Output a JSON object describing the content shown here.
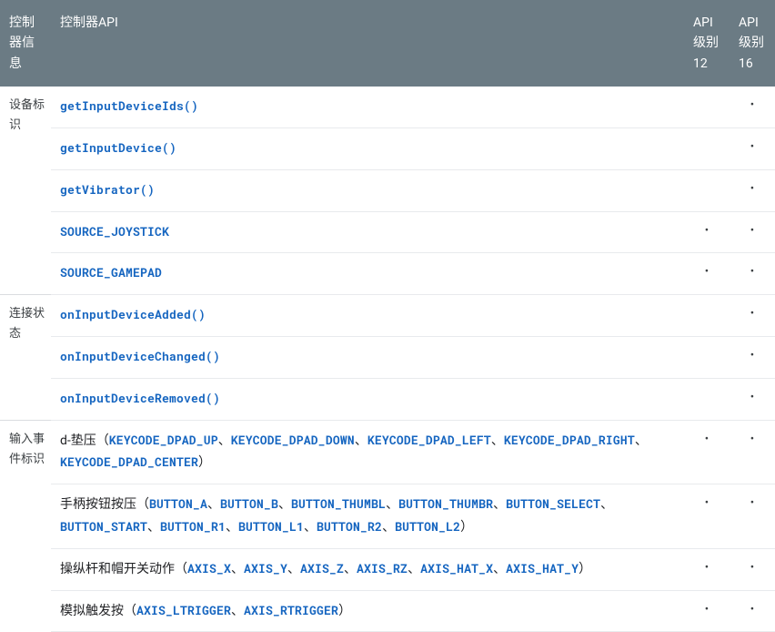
{
  "headers": {
    "info": "控制器信息",
    "controller_api": "控制器API",
    "api12": "API 级别 12",
    "api16": "API 级别 16"
  },
  "sections": [
    {
      "category": "设备标识",
      "rows": [
        {
          "type": "single",
          "items": [
            {
              "text": "getInputDeviceIds()",
              "link": true
            }
          ],
          "api12": "",
          "api16": "•"
        },
        {
          "type": "single",
          "items": [
            {
              "text": "getInputDevice()",
              "link": true
            }
          ],
          "api12": "",
          "api16": "•"
        },
        {
          "type": "single",
          "items": [
            {
              "text": "getVibrator()",
              "link": true
            }
          ],
          "api12": "",
          "api16": "•"
        },
        {
          "type": "single",
          "items": [
            {
              "text": "SOURCE_JOYSTICK",
              "link": true
            }
          ],
          "api12": "•",
          "api16": "•"
        },
        {
          "type": "single",
          "items": [
            {
              "text": "SOURCE_GAMEPAD",
              "link": true
            }
          ],
          "api12": "•",
          "api16": "•"
        }
      ]
    },
    {
      "category": "连接状态",
      "rows": [
        {
          "type": "single",
          "items": [
            {
              "text": "onInputDeviceAdded()",
              "link": true
            }
          ],
          "api12": "",
          "api16": "•"
        },
        {
          "type": "single",
          "items": [
            {
              "text": "onInputDeviceChanged()",
              "link": true
            }
          ],
          "api12": "",
          "api16": "•"
        },
        {
          "type": "single",
          "items": [
            {
              "text": "onInputDeviceRemoved()",
              "link": true
            }
          ],
          "api12": "",
          "api16": "•"
        }
      ]
    },
    {
      "category": "输入事件标识",
      "rows": [
        {
          "type": "composite",
          "prefix": "d-垫压（",
          "items": [
            {
              "text": "KEYCODE_DPAD_UP",
              "link": true
            },
            {
              "text": "KEYCODE_DPAD_DOWN",
              "link": true
            },
            {
              "text": "KEYCODE_DPAD_LEFT",
              "link": true
            },
            {
              "text": "KEYCODE_DPAD_RIGHT",
              "link": true
            },
            {
              "text": "KEYCODE_DPAD_CENTER",
              "link": true
            }
          ],
          "suffix": "）",
          "api12": "•",
          "api16": "•"
        },
        {
          "type": "composite",
          "prefix": "手柄按钮按压（",
          "items": [
            {
              "text": "BUTTON_A",
              "link": true
            },
            {
              "text": "BUTTON_B",
              "link": true
            },
            {
              "text": "BUTTON_THUMBL",
              "link": true
            },
            {
              "text": "BUTTON_THUMBR",
              "link": true
            },
            {
              "text": "BUTTON_SELECT",
              "link": true
            },
            {
              "text": "BUTTON_START",
              "link": true
            },
            {
              "text": "BUTTON_R1",
              "link": true
            },
            {
              "text": "BUTTON_L1",
              "link": true
            },
            {
              "text": "BUTTON_R2",
              "link": true
            },
            {
              "text": "BUTTON_L2",
              "link": true
            }
          ],
          "suffix": "）",
          "api12": "•",
          "api16": "•"
        },
        {
          "type": "composite",
          "prefix": "操纵杆和帽开关动作（",
          "items": [
            {
              "text": "AXIS_X",
              "link": true
            },
            {
              "text": "AXIS_Y",
              "link": true
            },
            {
              "text": "AXIS_Z",
              "link": true
            },
            {
              "text": "AXIS_RZ",
              "link": true
            },
            {
              "text": "AXIS_HAT_X",
              "link": true
            },
            {
              "text": "AXIS_HAT_Y",
              "link": true
            }
          ],
          "suffix": "）",
          "api12": "•",
          "api16": "•"
        },
        {
          "type": "composite",
          "prefix": "模拟触发按（",
          "items": [
            {
              "text": "AXIS_LTRIGGER",
              "link": true
            },
            {
              "text": "AXIS_RTRIGGER",
              "link": true
            }
          ],
          "suffix": "）",
          "api12": "•",
          "api16": "•"
        }
      ]
    }
  ]
}
